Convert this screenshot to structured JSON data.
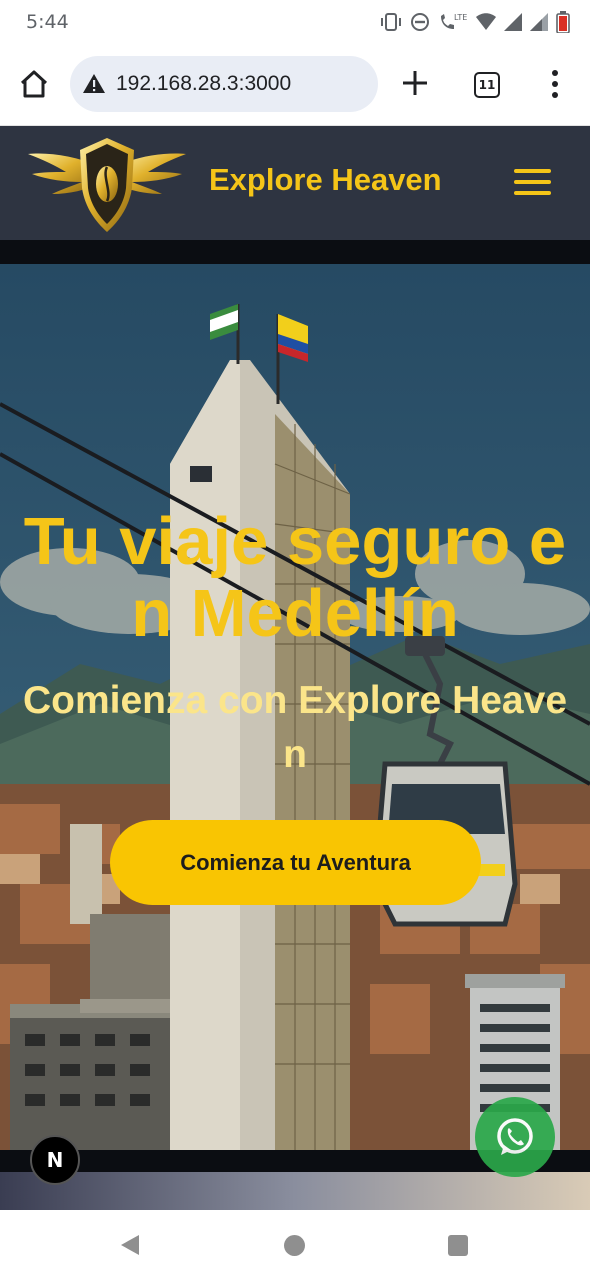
{
  "status_bar": {
    "time": "5:44",
    "lte_label": "LTE"
  },
  "browser": {
    "url": "192.168.28.3:3000",
    "tab_count": "11"
  },
  "site": {
    "brand": "Explore Heaven"
  },
  "hero": {
    "title": "Tu viaje seguro en Medellín",
    "subtitle": "Comienza con Explore Heaven",
    "cta_label": "Comienza tu Aventura"
  },
  "badges": {
    "next_label": "N"
  },
  "colors": {
    "accent": "#f5c518",
    "header_bg": "#2e3441",
    "cta_bg": "#f9c502",
    "whatsapp": "#2ba84a"
  },
  "icons": [
    "home-icon",
    "warning-icon",
    "plus-icon",
    "tabs-icon",
    "more-vert-icon",
    "hamburger-icon",
    "whatsapp-icon",
    "back-icon",
    "home-nav-icon",
    "recents-icon"
  ]
}
